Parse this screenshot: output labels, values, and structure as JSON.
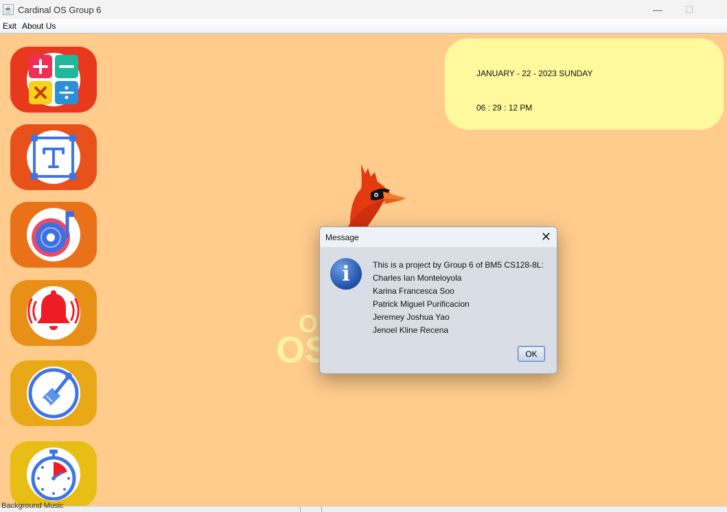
{
  "window": {
    "title": "Cardinal OS Group 6",
    "minimize_glyph": "—",
    "maximize_glyph": "☐"
  },
  "menu": {
    "items": [
      "Exit",
      "About Us"
    ]
  },
  "desktop": {
    "background_color": "#ffcc8d",
    "apps": [
      {
        "icon": "calculator-icon",
        "color": "#e8391e"
      },
      {
        "icon": "text-editor-icon",
        "color": "#e8511a"
      },
      {
        "icon": "music-player-icon",
        "color": "#e8711a"
      },
      {
        "icon": "alarm-bell-icon",
        "color": "#e88f18"
      },
      {
        "icon": "paint-brush-icon",
        "color": "#e8a818"
      },
      {
        "icon": "stopwatch-icon",
        "color": "#e8bd16"
      }
    ],
    "clock": {
      "date": "JANUARY - 22 - 2023 SUNDAY",
      "time": "06 : 29 : 12 PM",
      "panel_color": "#fff99d"
    },
    "watermark": {
      "small": "O",
      "big": "OS"
    }
  },
  "dialog": {
    "title": "Message",
    "icon": "info-icon",
    "lines": [
      "This is a project by Group 6 of BM5 CS128-8L:",
      "Charles Ian Monteloyola",
      "Karina Francesca Soo",
      "Patrick Miguel Purificacion",
      "Jeremey Joshua Yao",
      "Jenoel Kline Recena"
    ],
    "ok_label": "OK"
  },
  "status": {
    "text": "Background Music"
  }
}
